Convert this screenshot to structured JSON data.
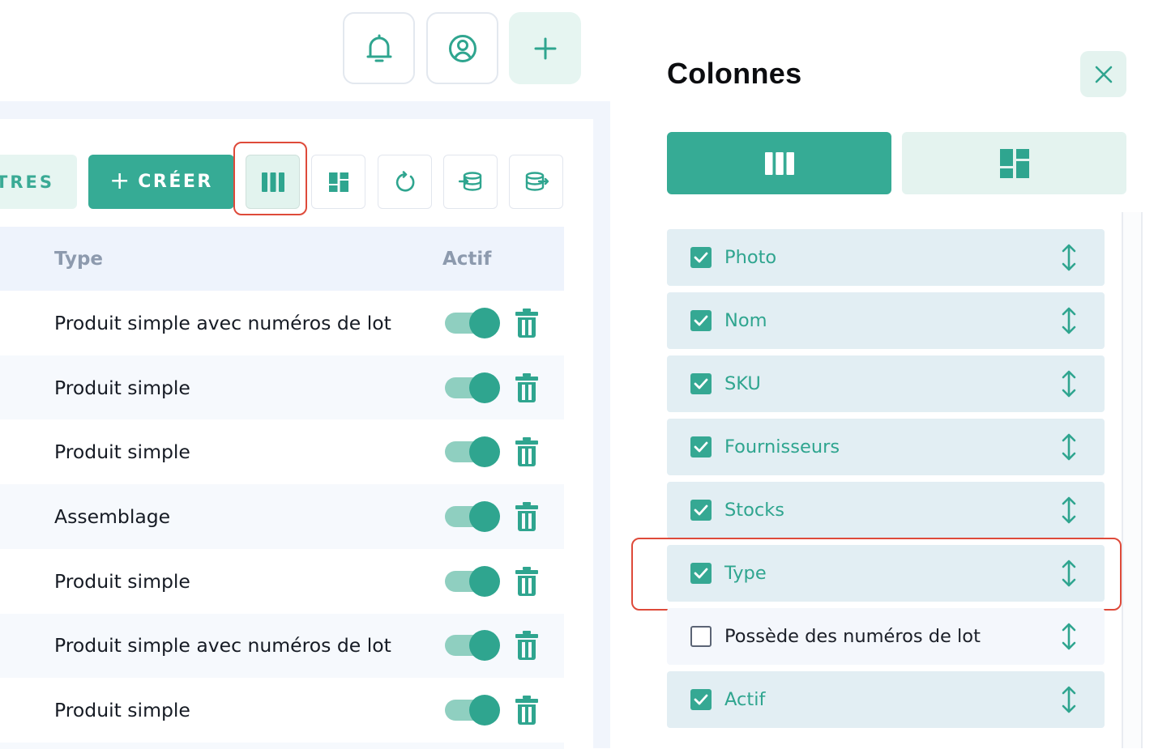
{
  "header": {
    "notifications_icon": "bell-icon",
    "profile_icon": "user-circle-icon",
    "add_icon": "plus-icon"
  },
  "toolbar": {
    "filters_label": "TRES",
    "create_plus": "+",
    "create_label": "CRÉER",
    "icons": [
      "columns-icon",
      "dashboard-icon",
      "refresh-icon",
      "database-import-icon",
      "database-export-icon"
    ]
  },
  "table": {
    "headers": {
      "type": "Type",
      "active": "Actif"
    },
    "rows": [
      {
        "type": "Produit simple avec numéros de lot",
        "active": true
      },
      {
        "type": "Produit simple",
        "active": true
      },
      {
        "type": "Produit simple",
        "active": true
      },
      {
        "type": "Assemblage",
        "active": true
      },
      {
        "type": "Produit simple",
        "active": true
      },
      {
        "type": "Produit simple avec numéros de lot",
        "active": true
      },
      {
        "type": "Produit simple",
        "active": true
      }
    ]
  },
  "drawer": {
    "title": "Colonnes",
    "close_icon": "close-icon",
    "segments": [
      {
        "icon": "columns-icon",
        "selected": true
      },
      {
        "icon": "dashboard-icon",
        "selected": false
      }
    ],
    "columns": [
      {
        "label": "Photo",
        "checked": true
      },
      {
        "label": "Nom",
        "checked": true
      },
      {
        "label": "SKU",
        "checked": true
      },
      {
        "label": "Fournisseurs",
        "checked": true
      },
      {
        "label": "Stocks",
        "checked": true
      },
      {
        "label": "Type",
        "checked": true
      },
      {
        "label": "Possède des numéros de lot",
        "checked": false
      },
      {
        "label": "Actif",
        "checked": true
      }
    ]
  },
  "colors": {
    "primary": "#36ab95",
    "primary_light": "#e4f3ef",
    "highlight": "#de4a3a",
    "toggle_track": "#8fcfc0",
    "column_item_bg": "#e2eef3"
  }
}
